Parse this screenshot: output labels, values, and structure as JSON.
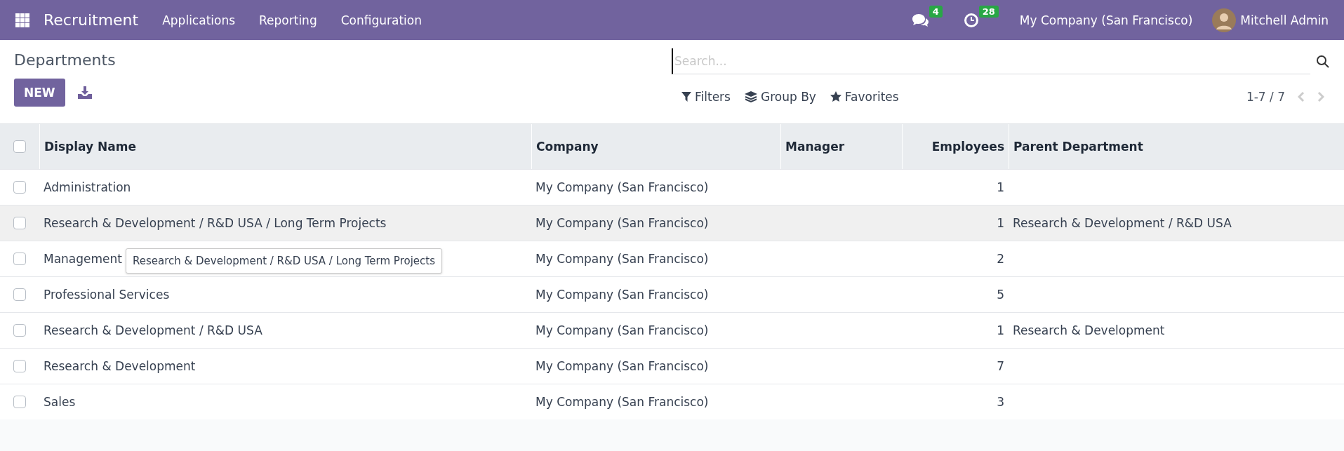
{
  "navbar": {
    "app_name": "Recruitment",
    "menu": [
      "Applications",
      "Reporting",
      "Configuration"
    ],
    "messages_count": "4",
    "activities_count": "28",
    "company": "My Company (San Francisco)",
    "user": "Mitchell Admin"
  },
  "control_panel": {
    "title": "Departments",
    "new_button": "NEW",
    "search": {
      "placeholder": "Search..."
    },
    "search_options": [
      {
        "kind": "filter",
        "label": "Filters"
      },
      {
        "kind": "group",
        "label": "Group By"
      },
      {
        "kind": "favorite",
        "label": "Favorites"
      }
    ],
    "pager": "1-7 / 7"
  },
  "table": {
    "all_checked": false,
    "columns": [
      {
        "label": "Display Name",
        "kind": "text"
      },
      {
        "label": "Company",
        "kind": "text"
      },
      {
        "label": "Manager",
        "kind": "text"
      },
      {
        "label": "Employees",
        "kind": "number"
      },
      {
        "label": "Parent Department",
        "kind": "text"
      }
    ],
    "rows": [
      {
        "checked": false,
        "hovered": false,
        "cells": [
          "Administration",
          "My Company (San Francisco)",
          "",
          "1",
          ""
        ]
      },
      {
        "checked": false,
        "hovered": true,
        "cells": [
          "Research & Development / R&D USA / Long Term Projects",
          "My Company (San Francisco)",
          "",
          "1",
          "Research & Development / R&D USA"
        ]
      },
      {
        "checked": false,
        "hovered": false,
        "cells": [
          "Management",
          "My Company (San Francisco)",
          "",
          "2",
          ""
        ]
      },
      {
        "checked": false,
        "hovered": false,
        "cells": [
          "Professional Services",
          "My Company (San Francisco)",
          "",
          "5",
          ""
        ]
      },
      {
        "checked": false,
        "hovered": false,
        "cells": [
          "Research & Development / R&D USA",
          "My Company (San Francisco)",
          "",
          "1",
          "Research & Development"
        ]
      },
      {
        "checked": false,
        "hovered": false,
        "cells": [
          "Research & Development",
          "My Company (San Francisco)",
          "",
          "7",
          ""
        ]
      },
      {
        "checked": false,
        "hovered": false,
        "cells": [
          "Sales",
          "My Company (San Francisco)",
          "",
          "3",
          ""
        ]
      }
    ]
  },
  "tooltip": {
    "text": "Research & Development / R&D USA / Long Term Projects"
  }
}
